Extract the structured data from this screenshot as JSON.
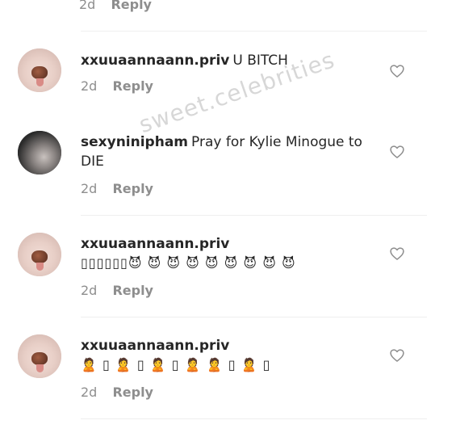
{
  "previous": {
    "time": "2d",
    "reply_label": "Reply"
  },
  "watermark": "sweet.celebrities",
  "comments": [
    {
      "username": "xxuuaannaann.priv",
      "text": "U BITCH",
      "time": "2d",
      "reply_label": "Reply",
      "avatar": "pig-nose-filter-avatar"
    },
    {
      "username": "sexyninipham",
      "text": "Pray for Kylie Minogue to DIE",
      "time": "2d",
      "reply_label": "Reply",
      "avatar": "profile-photo-avatar"
    },
    {
      "username": "xxuuaannaann.priv",
      "text": "▯▯▯▯▯▯😈 😈 😈 😈 😈 😈 😈 😈 😈",
      "time": "2d",
      "reply_label": "Reply",
      "avatar": "pig-nose-filter-avatar"
    },
    {
      "username": "xxuuaannaann.priv",
      "text": "🙎 ▯ 🙎 ▯ 🙎 ▯ 🙎 🙎 ▯ 🙎 ▯",
      "time": "2d",
      "reply_label": "Reply",
      "avatar": "pig-nose-filter-avatar"
    }
  ],
  "icons": {
    "like": "heart-outline-icon"
  },
  "colors": {
    "text": "#262626",
    "secondary": "#8e8e8e",
    "divider": "#efefef"
  }
}
